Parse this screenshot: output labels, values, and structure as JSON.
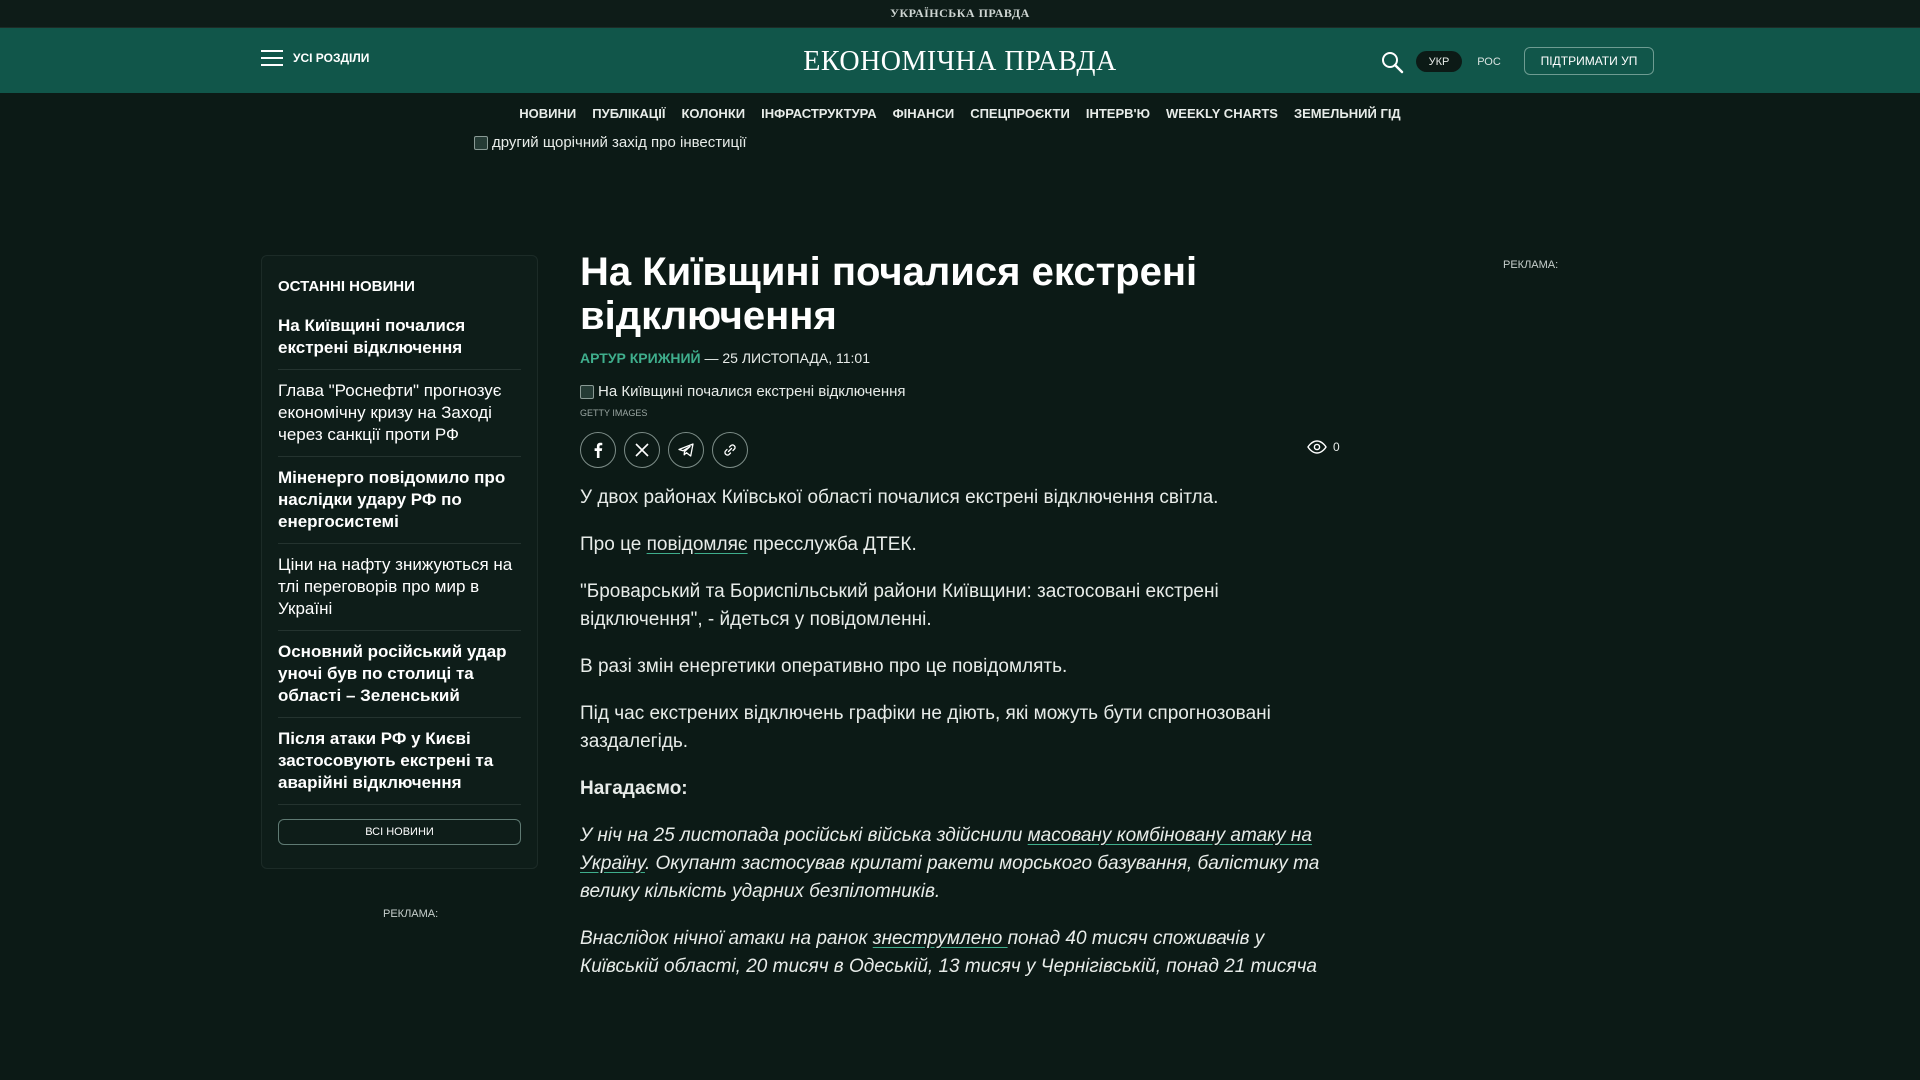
{
  "top_strip": {
    "title": "УКРАЇНСЬКА ПРАВДА"
  },
  "header": {
    "menu_label": "УСІ РОЗДІЛИ",
    "logo": "ЕКОНОМІЧНА ПРАВДА",
    "lang_ukr": "УКР",
    "lang_ros": "РОС",
    "support_label": "ПІДТРИМАТИ УП"
  },
  "nav": {
    "items": [
      "НОВИНИ",
      "ПУБЛІКАЦІЇ",
      "КОЛОНКИ",
      "ІНФРАСТРУКТУРА",
      "ФІНАНСИ",
      "СПЕЦПРОЄКТИ",
      "ІНТЕРВ'Ю",
      "WEEKLY CHARTS",
      "ЗЕМЕЛЬНИЙ ГІД"
    ]
  },
  "banner": {
    "alt": "другий щорічний захід про інвестиції"
  },
  "sidebar": {
    "title": "ОСТАННІ НОВИНИ",
    "items": [
      {
        "text": "На Київщині почалися екстрені відключення"
      },
      {
        "text": "Глава \"Роснефти\" прогнозує економічну кризу на Заході через санкції проти РФ"
      },
      {
        "text": "Міненерго повідомило про наслідки удару РФ по енергосистемі"
      },
      {
        "text": "Ціни на нафту знижуються на тлі переговорів про мир в Україні"
      },
      {
        "text": "Основний російський удар уночі був по столиці та області – Зеленський"
      },
      {
        "text": "Після атаки РФ у Києві застосовують екстрені та аварійні відключення"
      }
    ],
    "all_news": "ВСІ НОВИНИ",
    "ad_label": "РЕКЛАМА:"
  },
  "right_rail": {
    "ad_label": "РЕКЛАМА:"
  },
  "article": {
    "title": "На Київщині почалися екстрені відключення",
    "author": "АРТУР КРИЖНИЙ",
    "date": "— 25 ЛИСТОПАДА, 11:01",
    "photo_alt": "На Київщині почалися екстрені відключення",
    "photo_credit": "GETTY IMAGES",
    "views": "0",
    "p1": "У двох районах Київської області почалися екстрені відключення світла.",
    "p2_before": "Про це ",
    "p2_link": "повідомляє",
    "p2_after": " пресслужба ДТЕК.",
    "p3": "\"Броварський та Бориспільський райони Київщини: застосовані екстрені відключення\", - йдеться у повідомленні.",
    "p4": "В разі змін енергетики оперативно про це повідомлять.",
    "p5": "Під час екстрених відключень графіки не діють, які можуть бути спрогнозовані заздалегідь.",
    "p6": "Нагадаємо:",
    "p7_before": "У ніч на 25 листопада російські війська здійснили ",
    "p7_link": "масовану комбіновану атаку на Україну",
    "p7_after": ". Окупант застосував крилаті ракети морського базування, балістику та велику кількість ударних безпілотників.",
    "p8_before": "Внаслідок нічної атаки на ранок ",
    "p8_link": "знеструмлено ",
    "p8_after": "понад 40 тисяч споживачів у Київській області, 20 тисяч в Одеській, 13 тисяч у Чернігівській, понад 21 тисяча"
  }
}
